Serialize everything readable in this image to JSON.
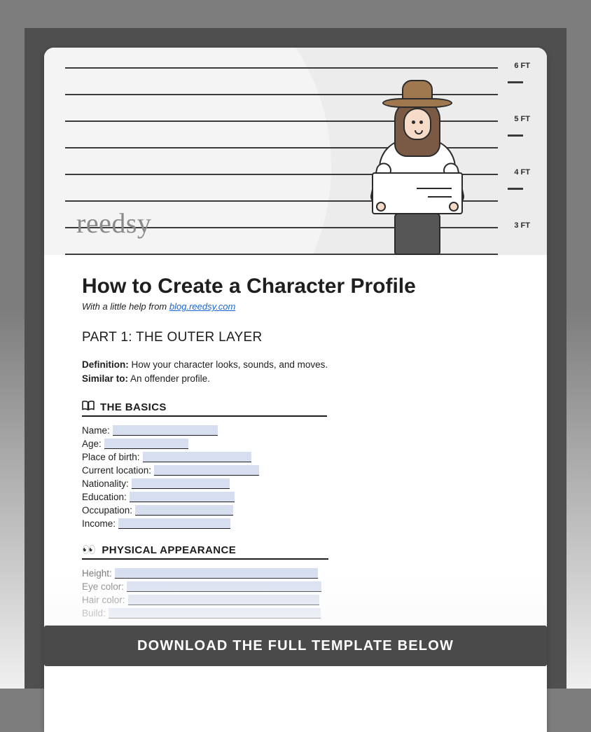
{
  "hero": {
    "brand": "reedsy",
    "height_labels": [
      "6 FT",
      "5 FT",
      "4 FT",
      "3 FT"
    ]
  },
  "title": "How to Create a Character Profile",
  "subtitle_prefix": "With a little help from ",
  "subtitle_link": "blog.reedsy.com",
  "part_heading": "PART 1: THE OUTER LAYER",
  "definition_label": "Definition:",
  "definition_text": " How your character looks, sounds, and moves.",
  "similar_label": "Similar to:",
  "similar_text": " An offender profile.",
  "sections": {
    "basics": {
      "title": "THE BASICS",
      "fields": [
        "Name:",
        "Age:",
        "Place of birth:",
        "Current location:",
        "Nationality:",
        "Education:",
        "Occupation:",
        "Income:"
      ]
    },
    "physical": {
      "title": "PHYSICAL APPEARANCE",
      "fields": [
        "Height:",
        "Eye color:",
        "Hair color:",
        "Build:"
      ]
    }
  },
  "cta": "DOWNLOAD THE FULL TEMPLATE BELOW"
}
